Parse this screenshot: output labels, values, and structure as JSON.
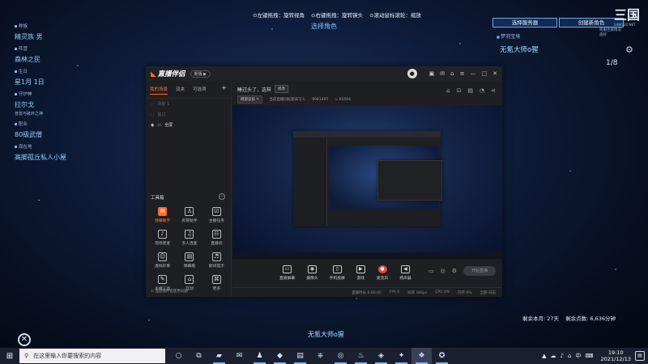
{
  "game": {
    "hints": [
      "⊙左键拖拽：旋转视角",
      "⊙右键拖拽：旋转镜头",
      "⊙滚动鼠标滚轮：缩放"
    ],
    "select_role": "选择角色",
    "left_info": [
      {
        "label": "种族",
        "value": "精灵族 男"
      },
      {
        "label": "阵营",
        "value": "森林之民"
      },
      {
        "label": "生日",
        "value": "星1月 1日"
      },
      {
        "label": "守护神",
        "value": "拉尔戈",
        "sub": "普雷与破坏之神"
      },
      {
        "label": "职业",
        "value": "80级武僧"
      },
      {
        "label": "现在地",
        "value": "高脚孤丘私人小屋"
      }
    ],
    "select_server": "选择服务器",
    "create_role": "创建新角色",
    "logo": "三国",
    "logo_sub": "SANGUO.NET",
    "server_hint": [
      "跨服连接情况",
      "良好"
    ],
    "realm": "梦羽宝境",
    "char_name": "无氪大师o猩",
    "page_counter": "1/8",
    "bottom_name": "无氪大师o猩",
    "remaining_time": "剩余本月: 27天",
    "remaining_points": "剩余点数: 6,636分钟",
    "back_icon": "x-circle-icon"
  },
  "app": {
    "logo": "直播伴侣",
    "version": "新版 ▶",
    "scene_tabs": [
      "我的场景",
      "双夹",
      "可选项"
    ],
    "sources": [
      {
        "name": "场景 1",
        "visible": false
      },
      {
        "name": "窗口",
        "visible": false
      },
      {
        "name": "全屏",
        "visible": true
      }
    ],
    "tools_title": "工具箱",
    "tools": [
      {
        "label": "弹幕助手",
        "icon": "✉",
        "hot": true
      },
      {
        "label": "房管助手",
        "icon": "♙",
        "hot": false
      },
      {
        "label": "主播任务",
        "icon": "☑",
        "hot": false
      },
      {
        "label": "现场连麦",
        "icon": "♪",
        "hot": false
      },
      {
        "label": "多人连麦",
        "icon": "♫",
        "hot": false
      },
      {
        "label": "直播间",
        "icon": "☷",
        "hot": false
      },
      {
        "label": "虚拟形象",
        "icon": "☺",
        "hot": false
      },
      {
        "label": "弹幕框",
        "icon": "▤",
        "hot": false
      },
      {
        "label": "歌词提示",
        "icon": "♬",
        "hot": false
      },
      {
        "label": "主播工具",
        "icon": "✎",
        "hot": false
      },
      {
        "label": "互动",
        "icon": "⌂",
        "hot": false
      },
      {
        "label": "更多",
        "icon": "⌘",
        "hot": false
      }
    ],
    "left_footer": "⊙ 当直播伴侣使用问题",
    "room_title": "睡过头了，这样",
    "modify_btn": "修改",
    "area_btn": "网游竞技 ✎",
    "room_note": "当前直播间标题未写入",
    "room_id": "9943495",
    "hot": "60594",
    "controls": [
      {
        "label": "直播屏幕",
        "icon": "▭"
      },
      {
        "label": "摄像头",
        "icon": "◉"
      },
      {
        "label": "手机投屏",
        "icon": "▯"
      },
      {
        "label": "游戏",
        "icon": "▶"
      },
      {
        "label": "麦克风",
        "icon": "●",
        "mic": true
      },
      {
        "label": "扬声器",
        "icon": "◀"
      }
    ],
    "start_live": "开始直播",
    "status": [
      "直播时长 0:00:00",
      "FPS 0",
      "码率 0kbps",
      "CPU 0%",
      "内存 0%",
      "全部 日志"
    ]
  },
  "taskbar": {
    "search_placeholder": "在这里输入你要搜索的内容",
    "apps": [
      {
        "icon": "○",
        "running": false,
        "active": false
      },
      {
        "icon": "⧉",
        "running": false,
        "active": false
      },
      {
        "icon": "▰",
        "running": true,
        "active": false
      },
      {
        "icon": "✉",
        "running": false,
        "active": false
      },
      {
        "icon": "♟",
        "running": true,
        "active": false
      },
      {
        "icon": "◆",
        "running": true,
        "active": false
      },
      {
        "icon": "▤",
        "running": true,
        "active": false
      },
      {
        "icon": "⎈",
        "running": false,
        "active": false
      },
      {
        "icon": "◎",
        "running": true,
        "active": false
      },
      {
        "icon": "♨",
        "running": true,
        "active": false
      },
      {
        "icon": "◈",
        "running": true,
        "active": false
      },
      {
        "icon": "✦",
        "running": true,
        "active": false
      },
      {
        "icon": "❖",
        "running": true,
        "active": true
      },
      {
        "icon": "✪",
        "running": true,
        "active": false
      }
    ],
    "tray": [
      "▲",
      "☁",
      "♪",
      "⌂",
      "中",
      "⌨"
    ],
    "time": "19:10",
    "date": "2021/12/13"
  }
}
